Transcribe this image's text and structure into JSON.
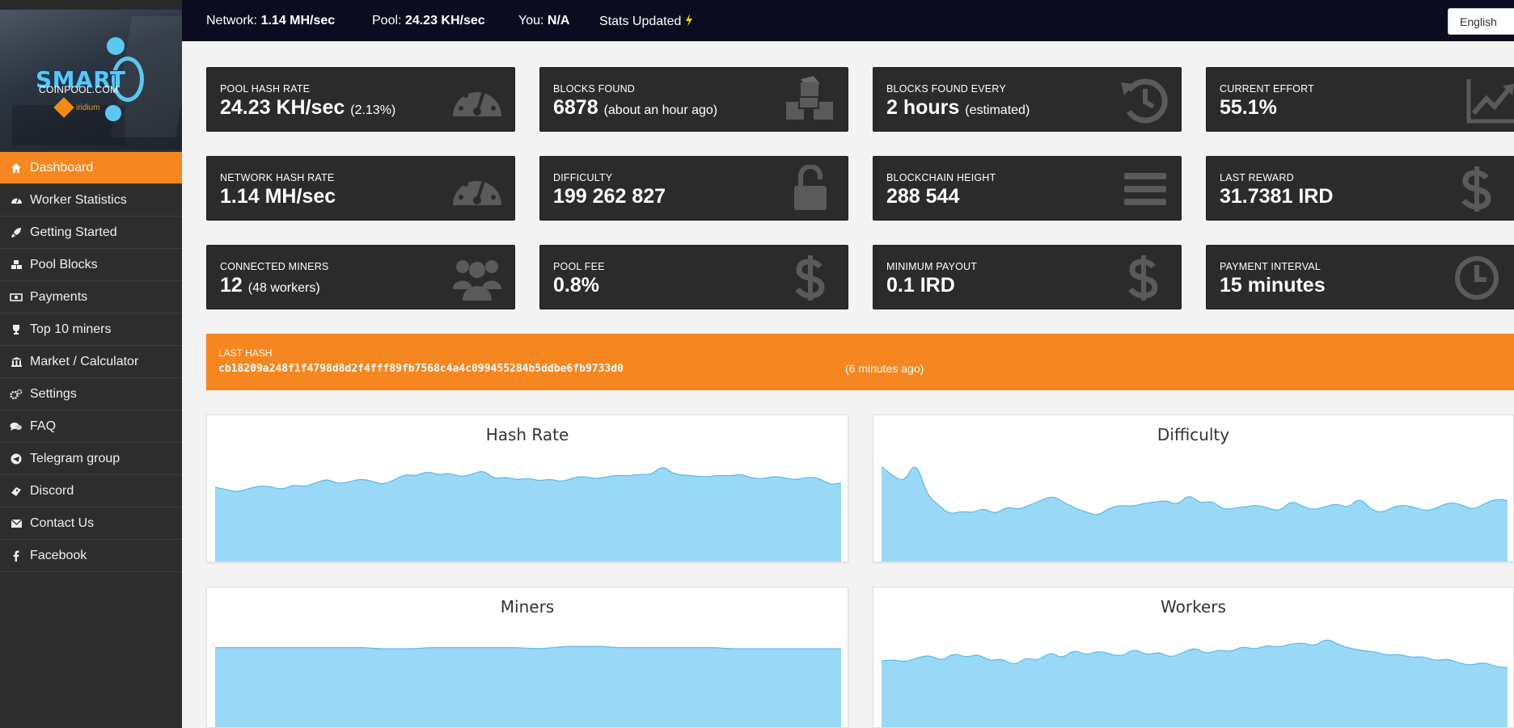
{
  "sidebar": {
    "logo": {
      "brand": "SMART",
      "sub": "COINPOOL.COM",
      "coin": "iridium"
    },
    "items": [
      {
        "label": "Dashboard",
        "icon": "home-icon",
        "active": true
      },
      {
        "label": "Worker Statistics",
        "icon": "tachometer-icon"
      },
      {
        "label": "Getting Started",
        "icon": "rocket-icon"
      },
      {
        "label": "Pool Blocks",
        "icon": "cubes-icon"
      },
      {
        "label": "Payments",
        "icon": "money-icon"
      },
      {
        "label": "Top 10 miners",
        "icon": "trophy-icon"
      },
      {
        "label": "Market / Calculator",
        "icon": "bank-icon"
      },
      {
        "label": "Settings",
        "icon": "gears-icon"
      },
      {
        "label": "FAQ",
        "icon": "comments-icon"
      },
      {
        "label": "Telegram group",
        "icon": "telegram-icon"
      },
      {
        "label": "Discord",
        "icon": "ticket-icon"
      },
      {
        "label": "Contact Us",
        "icon": "envelope-icon"
      },
      {
        "label": "Facebook",
        "icon": "facebook-icon"
      }
    ]
  },
  "topbar": {
    "network_label": "Network:",
    "network_value": "1.14 MH/sec",
    "pool_label": "Pool:",
    "pool_value": "24.23 KH/sec",
    "you_label": "You:",
    "you_value": "N/A",
    "stats_updated": "Stats Updated",
    "language": "English"
  },
  "cards": [
    {
      "label": "POOL HASH RATE",
      "value": "24.23 KH/sec",
      "extra": "(2.13%)",
      "icon": "tachometer-icon"
    },
    {
      "label": "BLOCKS FOUND",
      "value": "6878",
      "extra": "(about an hour ago)",
      "icon": "cubes-icon"
    },
    {
      "label": "BLOCKS FOUND EVERY",
      "value": "2 hours",
      "extra": "(estimated)",
      "icon": "history-icon"
    },
    {
      "label": "CURRENT EFFORT",
      "value": "55.1%",
      "extra": "",
      "icon": "line-chart-icon"
    },
    {
      "label": "NETWORK HASH RATE",
      "value": "1.14 MH/sec",
      "extra": "",
      "icon": "tachometer-icon"
    },
    {
      "label": "DIFFICULTY",
      "value": "199 262 827",
      "extra": "",
      "icon": "unlock-icon"
    },
    {
      "label": "BLOCKCHAIN HEIGHT",
      "value": "288 544",
      "extra": "",
      "icon": "bars-icon"
    },
    {
      "label": "LAST REWARD",
      "value": "31.7381 IRD",
      "extra": "",
      "icon": "dollar-icon"
    },
    {
      "label": "CONNECTED MINERS",
      "value": "12",
      "extra": "(48 workers)",
      "icon": "users-icon"
    },
    {
      "label": "POOL FEE",
      "value": "0.8%",
      "extra": "",
      "icon": "dollar-icon"
    },
    {
      "label": "MINIMUM PAYOUT",
      "value": "0.1 IRD",
      "extra": "",
      "icon": "dollar-icon"
    },
    {
      "label": "PAYMENT INTERVAL",
      "value": "15 minutes",
      "extra": "",
      "icon": "clock-icon"
    }
  ],
  "last_hash": {
    "label": "LAST HASH",
    "hash": "cb18209a248f1f4798d8d2f4fff89fb7568c4a4c099455284b5ddbe6fb9733d0",
    "ago": "(6 minutes ago)"
  },
  "colors": {
    "accent": "#f6861f",
    "topbar": "#0c0c20",
    "sidebar": "#2d2d2d",
    "card": "#2b2b2b",
    "stats_updated": "#e3d91f",
    "chart_fill": "#99d9f7",
    "chart_line": "#5bbbe8"
  },
  "chart_data": [
    {
      "type": "area",
      "title": "Hash Rate",
      "values": [
        0.55,
        0.5,
        0.45,
        0.52,
        0.58,
        0.56,
        0.5,
        0.6,
        0.56,
        0.64,
        0.72,
        0.62,
        0.66,
        0.72,
        0.68,
        0.6,
        0.7,
        0.82,
        0.78,
        0.88,
        0.8,
        0.84,
        0.76,
        0.82,
        0.9,
        0.72,
        0.76,
        0.7,
        0.74,
        0.68,
        0.72,
        0.66,
        0.74,
        0.78,
        0.72,
        0.76,
        0.8,
        0.78,
        0.82,
        0.8,
        1.0,
        0.82,
        0.8,
        0.78,
        0.76,
        0.8,
        0.78,
        0.82,
        0.74,
        0.72,
        0.78,
        0.74,
        0.7,
        0.76,
        0.74,
        0.6,
        0.64
      ]
    },
    {
      "type": "area",
      "title": "Difficulty",
      "values": [
        0.92,
        0.8,
        0.72,
        1.0,
        0.55,
        0.42,
        0.3,
        0.34,
        0.32,
        0.38,
        0.3,
        0.4,
        0.36,
        0.42,
        0.48,
        0.54,
        0.46,
        0.38,
        0.33,
        0.28,
        0.38,
        0.42,
        0.4,
        0.44,
        0.46,
        0.48,
        0.42,
        0.56,
        0.44,
        0.48,
        0.36,
        0.38,
        0.4,
        0.42,
        0.38,
        0.34,
        0.48,
        0.4,
        0.36,
        0.4,
        0.44,
        0.38,
        0.52,
        0.36,
        0.32,
        0.4,
        0.42,
        0.38,
        0.34,
        0.4,
        0.46,
        0.42,
        0.36,
        0.44,
        0.5,
        0.48
      ]
    },
    {
      "type": "area",
      "title": "Miners",
      "values": [
        0.95,
        0.95,
        0.95,
        0.95,
        0.95,
        0.95,
        0.95,
        0.95,
        0.95,
        0.95,
        0.95,
        0.95,
        0.95,
        0.9,
        0.9,
        0.9,
        0.9,
        0.95,
        0.95,
        0.95,
        0.95,
        0.95,
        0.95,
        0.95,
        0.95,
        0.92,
        0.9,
        0.95,
        1.0,
        1.0,
        1.0,
        1.0,
        0.95,
        0.95,
        0.95,
        0.95,
        0.95,
        0.95,
        0.95,
        0.95,
        0.95,
        0.9,
        0.9,
        0.9,
        0.9,
        0.9,
        0.9,
        0.9,
        0.9,
        0.9,
        0.9
      ]
    },
    {
      "type": "area",
      "title": "Workers",
      "values": [
        0.6,
        0.62,
        0.58,
        0.66,
        0.7,
        0.6,
        0.74,
        0.66,
        0.72,
        0.6,
        0.64,
        0.52,
        0.66,
        0.6,
        0.76,
        0.64,
        0.8,
        0.7,
        0.78,
        0.72,
        0.68,
        0.82,
        0.7,
        0.76,
        0.66,
        0.74,
        0.84,
        0.72,
        0.8,
        0.76,
        0.86,
        0.8,
        0.88,
        0.84,
        0.9,
        0.92,
        0.86,
        1.0,
        0.88,
        0.82,
        0.78,
        0.76,
        0.7,
        0.72,
        0.66,
        0.68,
        0.6,
        0.64,
        0.56,
        0.52,
        0.58,
        0.5,
        0.48
      ]
    }
  ]
}
